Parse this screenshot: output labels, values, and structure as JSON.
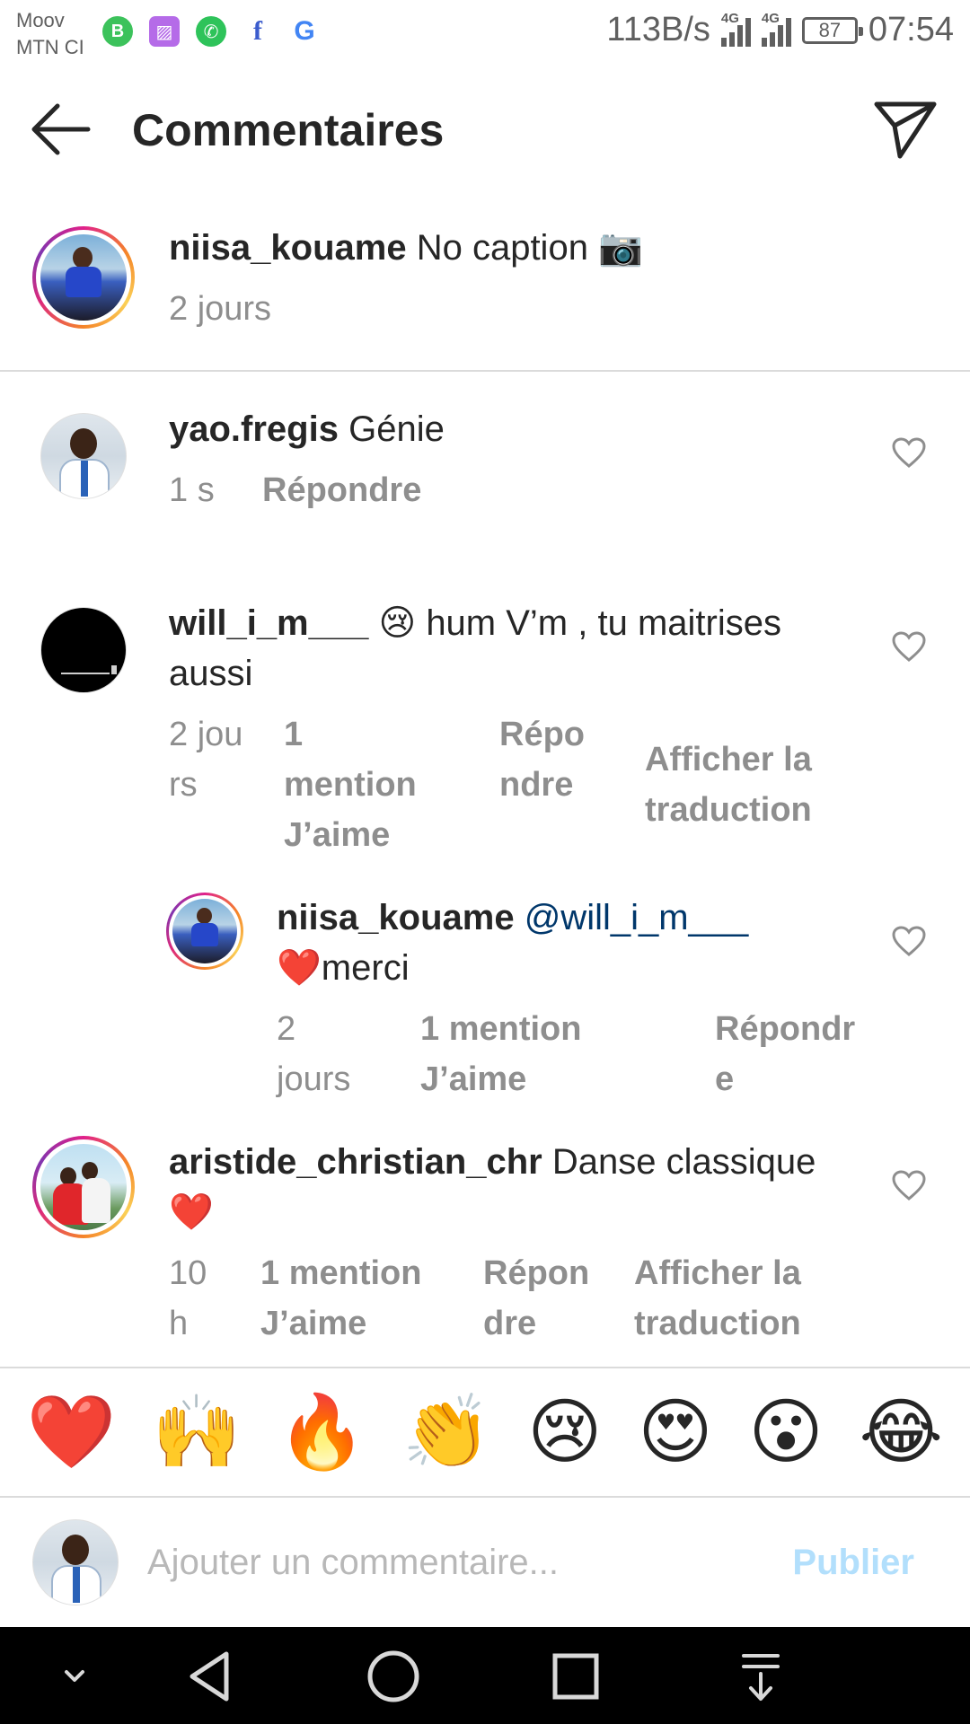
{
  "status_bar": {
    "carrier_1": "Moov",
    "carrier_2": "MTN CI",
    "speed": "113B/s",
    "network_1": "4G",
    "network_2": "4G",
    "battery": "87",
    "time": "07:54"
  },
  "header": {
    "title": "Commentaires"
  },
  "caption": {
    "username": "niisa_kouame",
    "text": "No caption 📷",
    "time": "2 jours"
  },
  "comments": [
    {
      "username": "yao.fregis",
      "text": "Génie",
      "time": "1 s",
      "reply": "Répondre"
    },
    {
      "username": "will_i_m___",
      "text": "😢 hum V’m , tu maitrises aussi",
      "time": "2 jours",
      "likes": "1 mention J’aime",
      "reply": "Répondre",
      "translate": "Afficher la traduction"
    },
    {
      "username": "niisa_kouame",
      "mention": "@will_i_m___",
      "text": "❤️merci",
      "time": "2 jours",
      "likes": "1 mention J’aime",
      "reply": "Répondre"
    },
    {
      "username": "aristide_christian_chr",
      "text": "Danse classique❤️",
      "time": "10 h",
      "likes": "1 mention J’aime",
      "reply": "Répondre",
      "translate": "Afficher la traduction"
    }
  ],
  "emoji_bar": [
    "❤️",
    "🙌",
    "🔥",
    "👏",
    "😢",
    "😍",
    "😮",
    "😂"
  ],
  "input": {
    "placeholder": "Ajouter un commentaire...",
    "publish_label": "Publier"
  },
  "colors": {
    "text": "#262626",
    "secondary": "#8e8e8e",
    "mention": "#00376b",
    "publish_disabled": "#b2dffc"
  }
}
